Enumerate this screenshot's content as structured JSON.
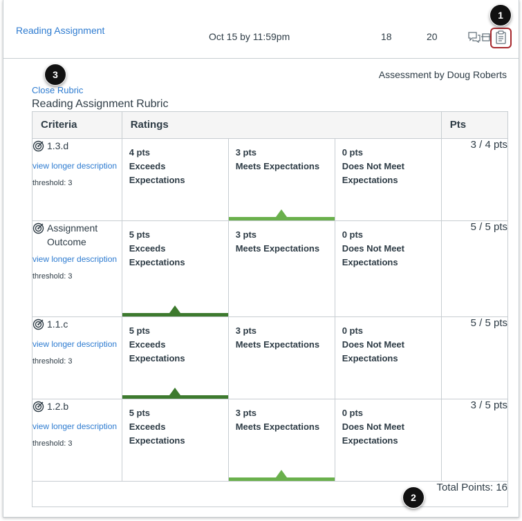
{
  "assignment": {
    "name": "Reading Assignment",
    "due": "Oct 15 by 11:59pm",
    "score": "18",
    "out_of": "20"
  },
  "icons": {
    "comments": "comment-icon",
    "muted": "muted-icon",
    "rubric": "rubric-icon"
  },
  "callouts": {
    "one": "1",
    "two": "2",
    "three": "3"
  },
  "assessment_by": "Assessment by Doug Roberts",
  "close_rubric": "Close Rubric",
  "rubric_title": "Reading Assignment Rubric",
  "headers": {
    "criteria": "Criteria",
    "ratings": "Ratings",
    "pts": "Pts"
  },
  "criteria": [
    {
      "name": "1.3.d",
      "link": "view longer description",
      "threshold": "threshold: 3",
      "ratings": [
        {
          "pts": "4 pts",
          "desc": "Exceeds Expectations"
        },
        {
          "pts": "3 pts",
          "desc": "Meets Expectations"
        },
        {
          "pts": "0 pts",
          "desc": "Does Not Meet Expectations"
        }
      ],
      "selected": 1,
      "score": "3 / 4 pts"
    },
    {
      "name": "Assignment Outcome",
      "link": "view longer description",
      "threshold": "threshold: 3",
      "ratings": [
        {
          "pts": "5 pts",
          "desc": "Exceeds Expectations"
        },
        {
          "pts": "3 pts",
          "desc": "Meets Expectations"
        },
        {
          "pts": "0 pts",
          "desc": "Does Not Meet Expectations"
        }
      ],
      "selected": 0,
      "score": "5 / 5 pts"
    },
    {
      "name": "1.1.c",
      "link": "view longer description",
      "threshold": "threshold: 3",
      "ratings": [
        {
          "pts": "5 pts",
          "desc": "Exceeds Expectations"
        },
        {
          "pts": "3 pts",
          "desc": "Meets Expectations"
        },
        {
          "pts": "0 pts",
          "desc": "Does Not Meet Expectations"
        }
      ],
      "selected": 0,
      "score": "5 / 5 pts"
    },
    {
      "name": "1.2.b",
      "link": "view longer description",
      "threshold": "threshold: 3",
      "ratings": [
        {
          "pts": "5 pts",
          "desc": "Exceeds Expectations"
        },
        {
          "pts": "3 pts",
          "desc": "Meets Expectations"
        },
        {
          "pts": "0 pts",
          "desc": "Does Not Meet Expectations"
        }
      ],
      "selected": 1,
      "score": "3 / 5 pts"
    }
  ],
  "colors": {
    "link": "#2d7bd0",
    "meets": "#6ab04c",
    "exceeds": "#3d7a2e",
    "highlight_border": "#a7282d"
  },
  "total_points": "Total Points: 16"
}
